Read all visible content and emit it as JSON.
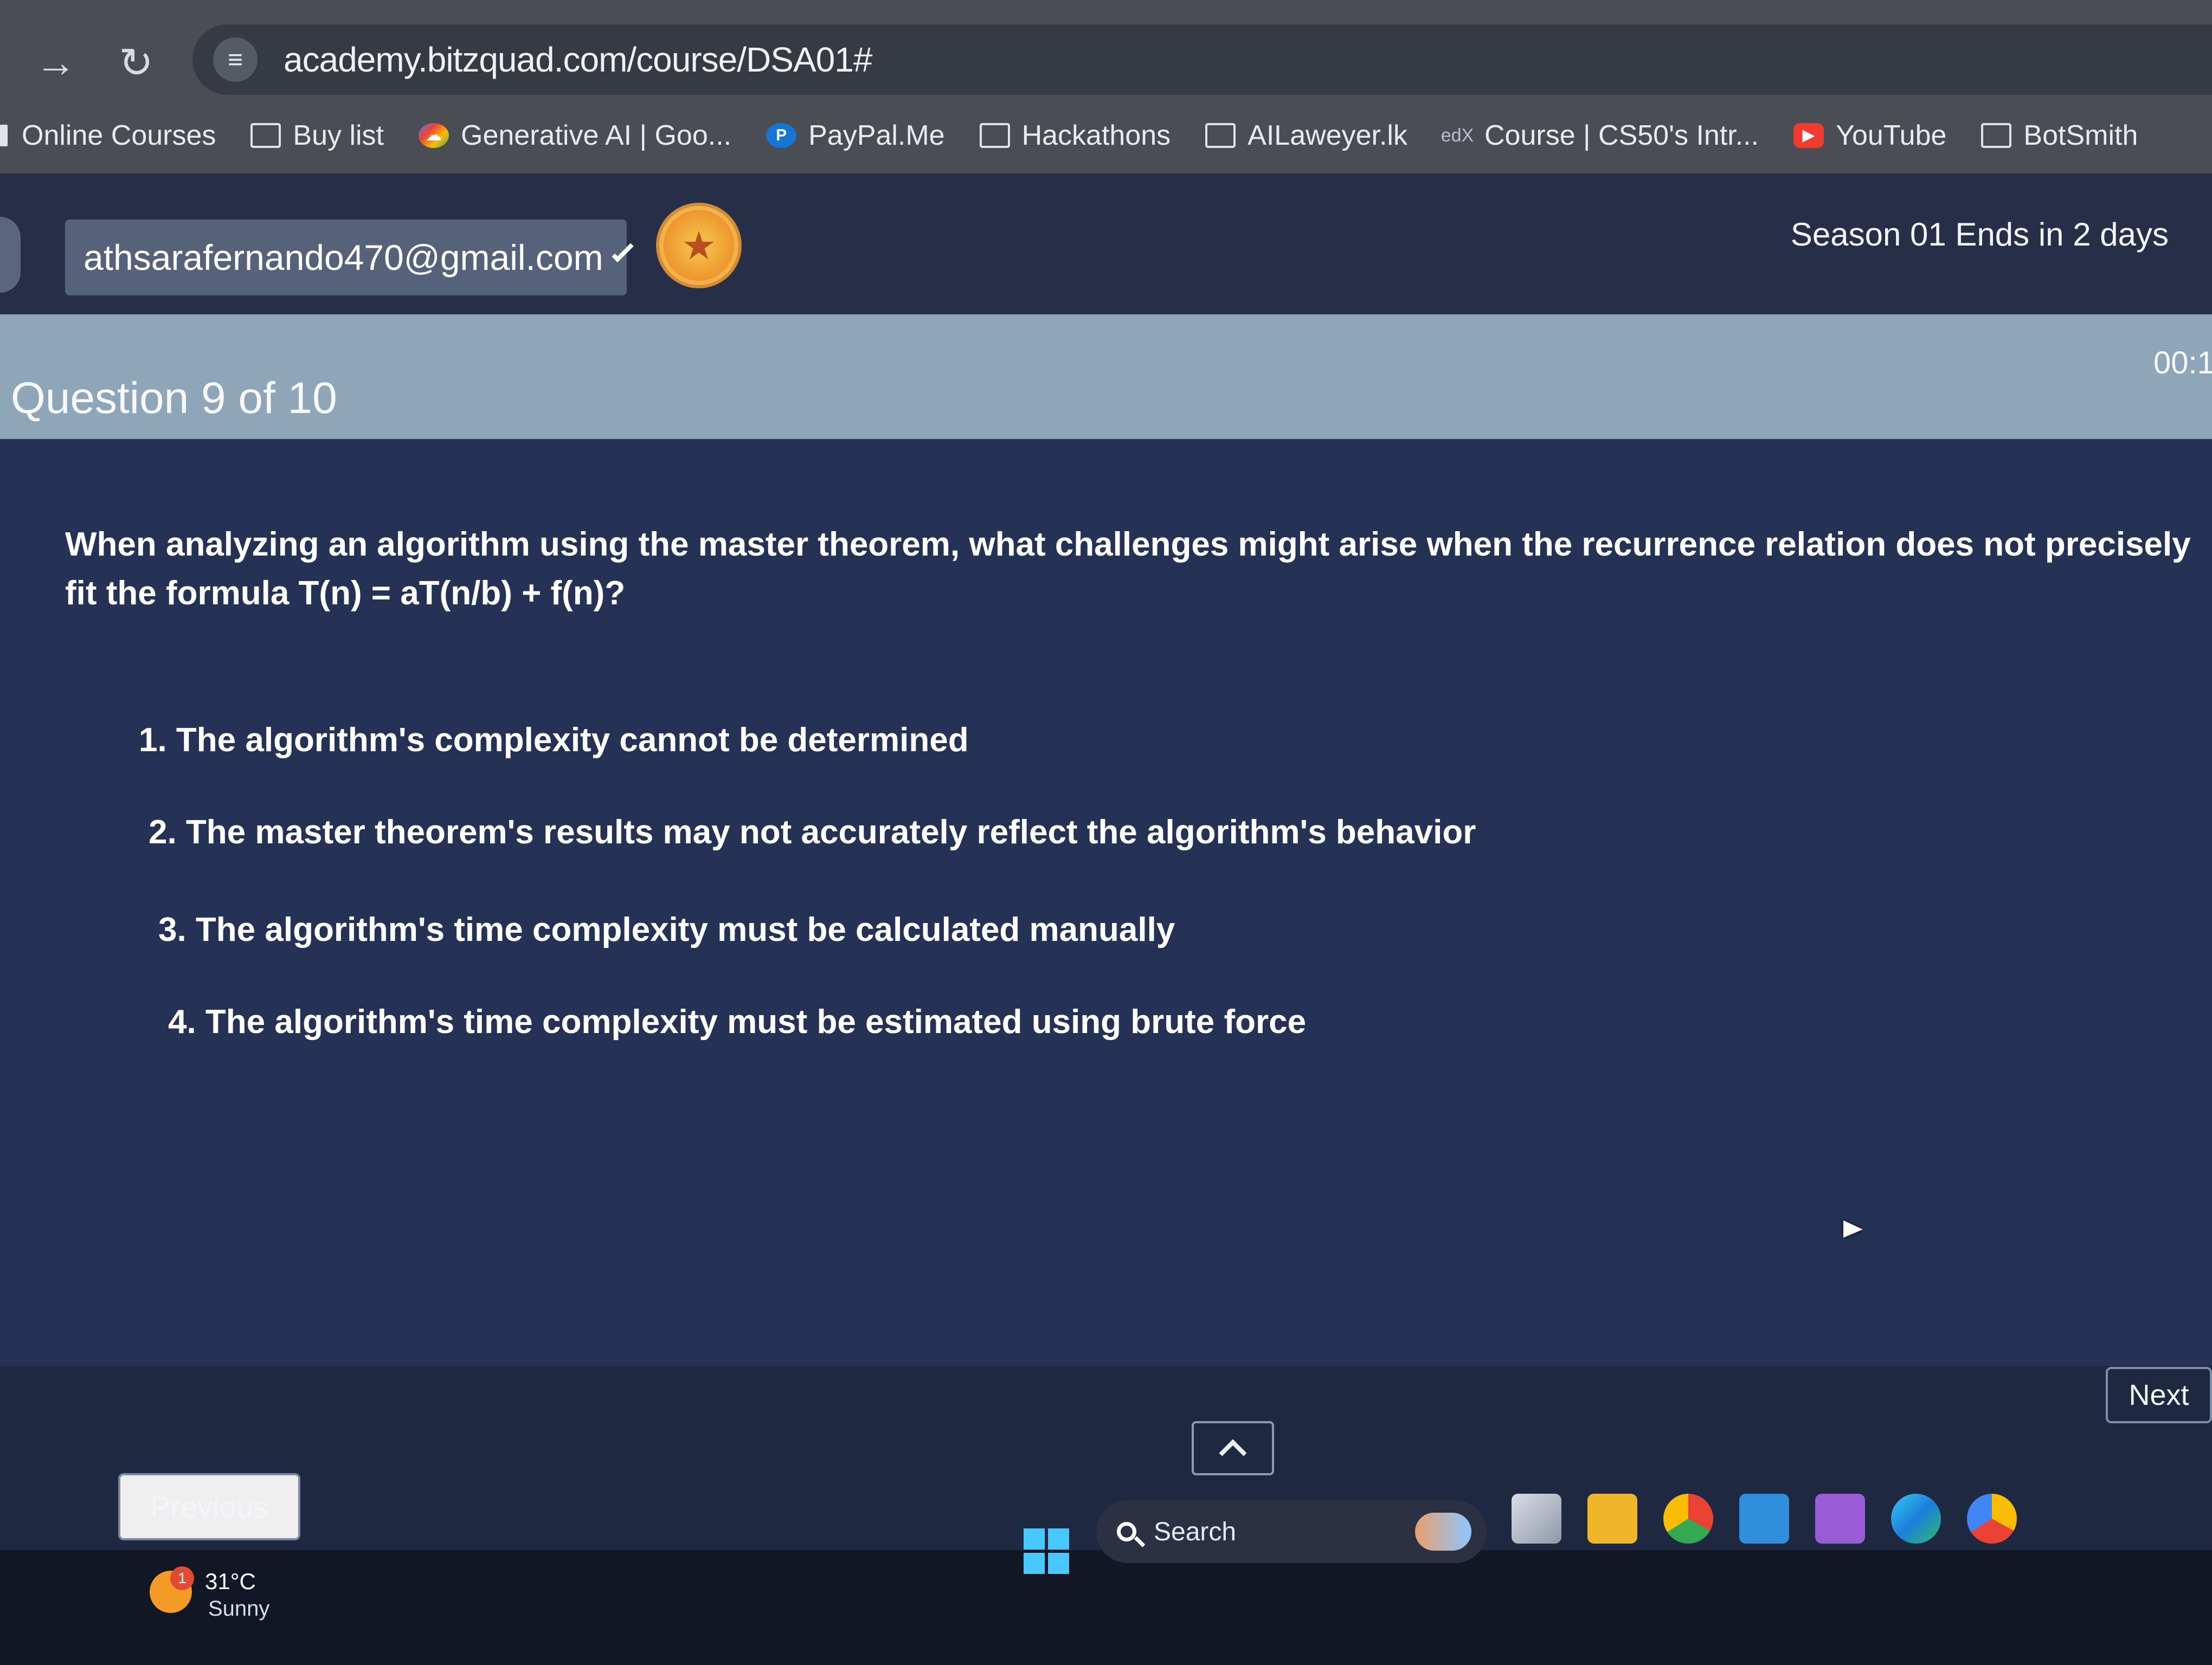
{
  "browser": {
    "url": "academy.bitzquad.com/course/DSA01#",
    "bookmarks": [
      {
        "label": "Online Courses",
        "icon": "folder-icon"
      },
      {
        "label": "Buy list",
        "icon": "folder-icon"
      },
      {
        "label": "Generative AI | Goo...",
        "icon": "google-cloud-icon"
      },
      {
        "label": "PayPal.Me",
        "icon": "paypal-icon"
      },
      {
        "label": "Hackathons",
        "icon": "folder-icon"
      },
      {
        "label": "AILaweyer.lk",
        "icon": "folder-icon"
      },
      {
        "label": "Course | CS50's Intr...",
        "icon": "edx-icon"
      },
      {
        "label": "YouTube",
        "icon": "youtube-icon"
      },
      {
        "label": "BotSmith",
        "icon": "folder-icon"
      }
    ]
  },
  "header": {
    "account_email": "athsarafernando470@gmail.com",
    "season_text": "Season 01 Ends in 2 days"
  },
  "quiz": {
    "counter": "Question 9 of 10",
    "timer": "00:1",
    "question": "When analyzing an algorithm using the master theorem, what challenges might arise when the recurrence relation does not precisely fit the formula T(n) = aT(n/b) + f(n)?",
    "options": [
      "1. The algorithm's complexity cannot be determined",
      "2. The master theorem's results may not accurately reflect the algorithm's behavior",
      "3. The algorithm's time complexity must be calculated manually",
      "4. The algorithm's time complexity must be estimated using brute force"
    ],
    "next_label": "Next",
    "previous_label": "Previous"
  },
  "taskbar": {
    "weather_temp": "31°C",
    "weather_condition": "Sunny",
    "weather_alert_count": "1",
    "search_label": "Search"
  },
  "colors": {
    "browser_chrome": "#4a4d54",
    "app_header": "#262f47",
    "question_band": "#8fa5b8",
    "quiz_background": "#253255"
  }
}
